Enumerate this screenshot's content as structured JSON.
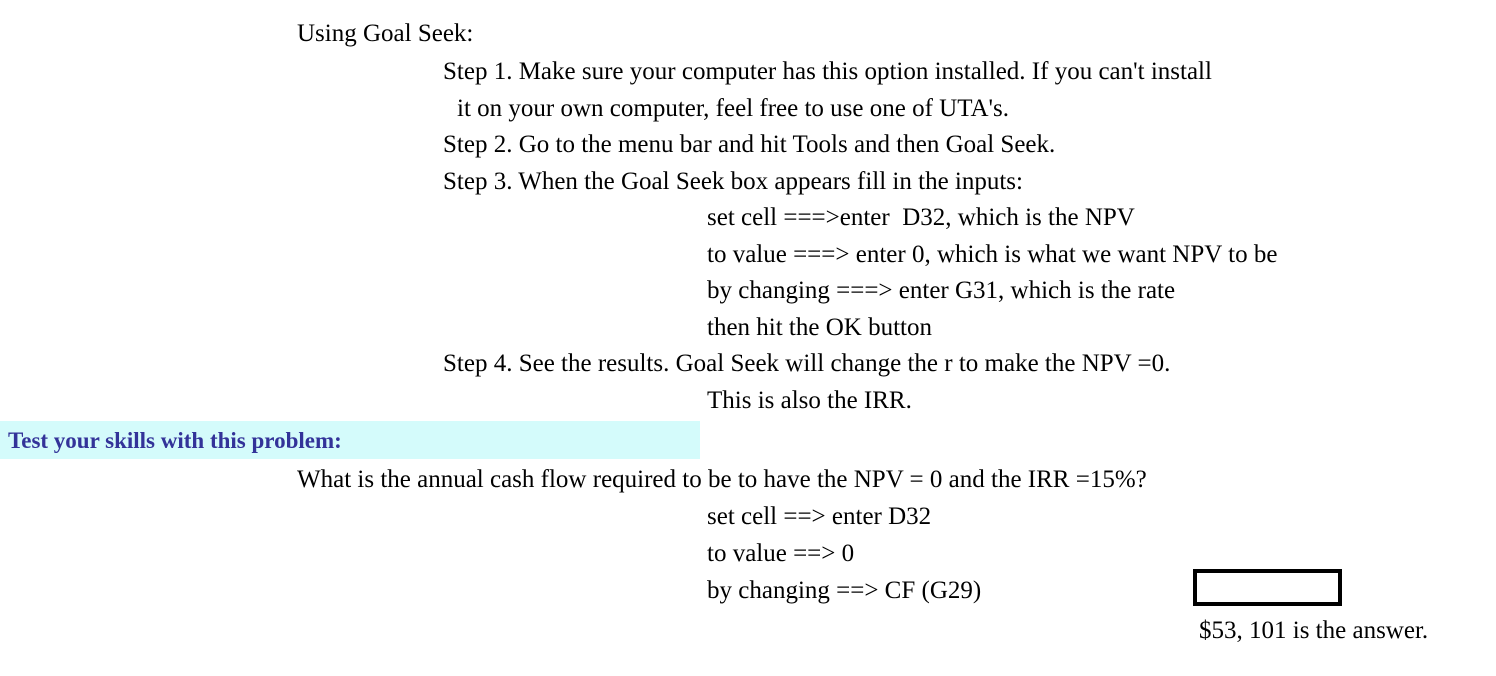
{
  "document": {
    "background_color": "#ffffff",
    "text_color": "#000000",
    "intro": {
      "title": "Using Goal Seek:"
    },
    "steps": [
      {
        "id": "step-1",
        "text": "Step 1. Make sure your computer has this option installed. If you can't install"
      },
      {
        "id": "step-1-cont",
        "text": "it on your own computer, feel free to use one of UTA's."
      },
      {
        "id": "step-2",
        "text": "Step 2. Go to the menu bar and hit Tools and then Goal Seek."
      },
      {
        "id": "step-3",
        "text": "Step 3. When the Goal Seek box appears fill in the inputs:"
      }
    ],
    "step3_inputs": [
      {
        "id": "set-cell",
        "text": "set cell ===>enter  D32, which is the NPV"
      },
      {
        "id": "to-value",
        "text": "to value ===> enter 0, which is what we want NPV to be"
      },
      {
        "id": "by-changing",
        "text": "by changing ===> enter G31, which is the rate"
      },
      {
        "id": "ok-button",
        "text": "then hit the OK button"
      }
    ],
    "step4": {
      "line1": "Step 4. See the results. Goal Seek will change the r to make the NPV =0.",
      "line2": "This is also the IRR."
    },
    "section_heading": {
      "text": "Test your skills with this problem:",
      "text_color": "#333399",
      "highlight_color": "#d4fbfb"
    },
    "problem": {
      "question": "What is the annual cash flow required to be to have the NPV = 0 and the IRR =15%?",
      "inputs": [
        {
          "id": "set-cell",
          "text": "set cell ==> enter D32"
        },
        {
          "id": "to-value",
          "text": "to value ==> 0"
        },
        {
          "id": "by-changing",
          "text": "by changing ==> CF (G29)"
        }
      ],
      "answer_box_value": "",
      "answer_text": "$53, 101 is the answer."
    }
  }
}
